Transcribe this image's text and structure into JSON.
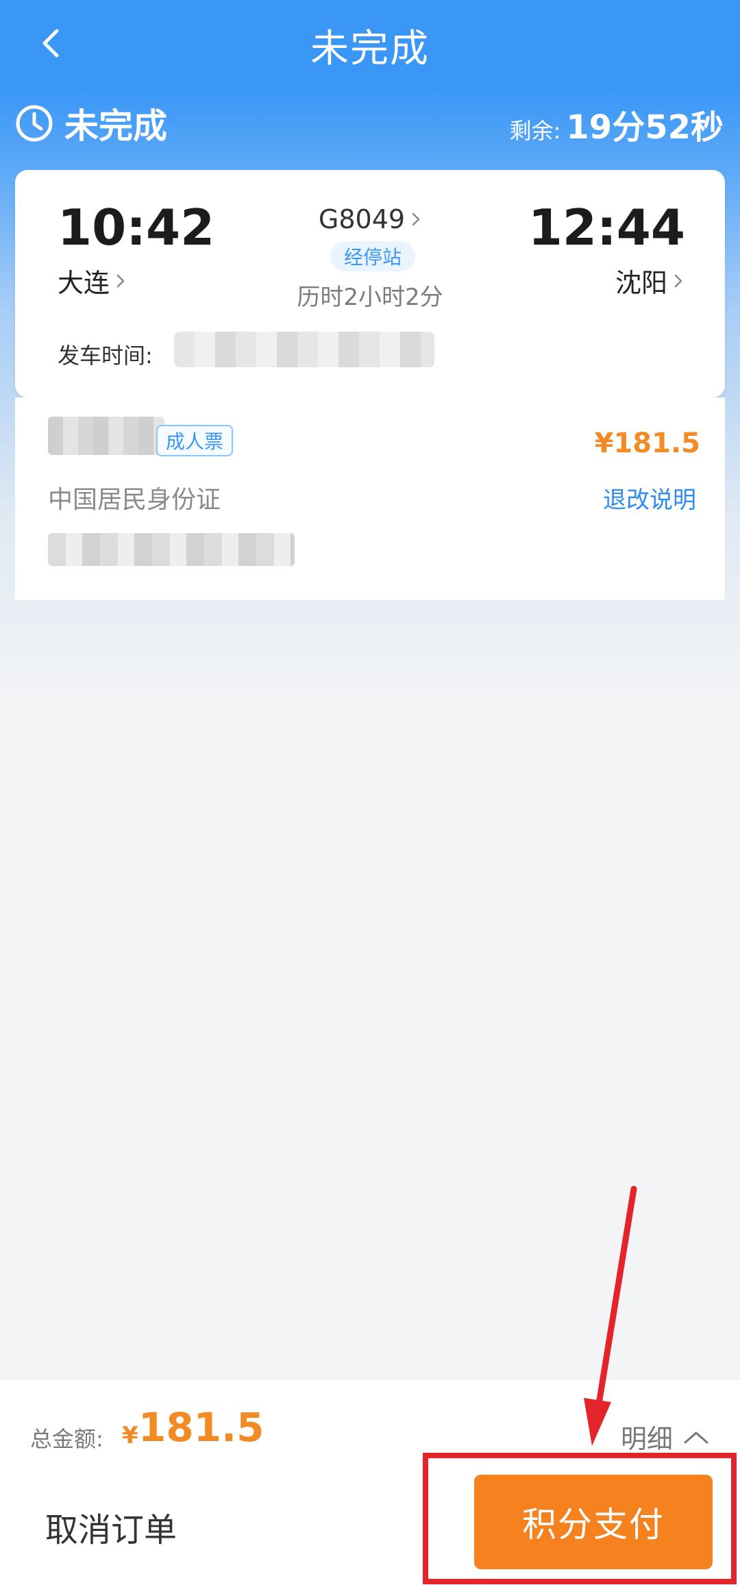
{
  "header": {
    "title": "未完成"
  },
  "status": {
    "text": "未完成",
    "remaining_label": "剩余:",
    "remaining_value": "19分52秒"
  },
  "train": {
    "departure_time": "10:42",
    "arrival_time": "12:44",
    "departure_station": "大连",
    "arrival_station": "沈阳",
    "train_number": "G8049",
    "stops_label": "经停站",
    "duration": "历时2小时2分",
    "departure_date_label": "发车时间:"
  },
  "passenger": {
    "ticket_type": "成人票",
    "price": "¥181.5",
    "id_type": "中国居民身份证",
    "refund_label": "退改说明"
  },
  "footer": {
    "total_label": "总金额:",
    "currency": "¥",
    "total_amount": "181.5",
    "detail_label": "明细",
    "cancel_label": "取消订单",
    "pay_label": "积分支付"
  },
  "colors": {
    "primary_blue": "#3a97f6",
    "price_orange": "#f38b24",
    "pay_button": "#f5811f",
    "annotation_red": "#e3242b"
  },
  "icons": {
    "back": "back-arrow-icon",
    "clock": "clock-icon",
    "chevron": "chevron-right-icon",
    "up": "chevron-up-icon"
  }
}
